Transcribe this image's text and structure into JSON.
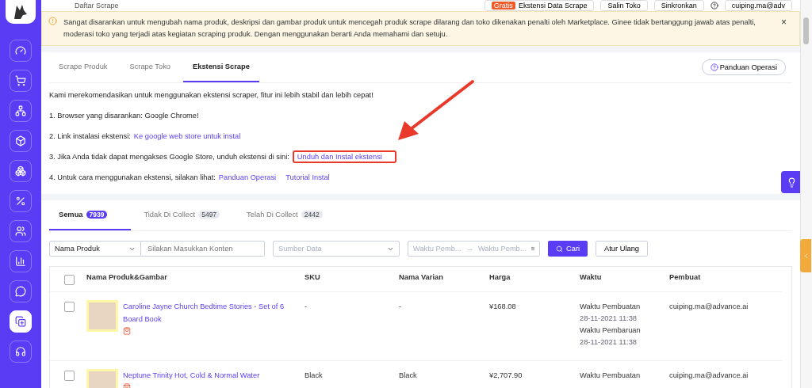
{
  "sidebar": {
    "items": [
      {
        "selected": false
      },
      {
        "selected": false
      },
      {
        "selected": false
      },
      {
        "selected": false
      },
      {
        "selected": false
      },
      {
        "selected": false
      },
      {
        "selected": false
      },
      {
        "selected": false
      },
      {
        "selected": false
      },
      {
        "selected": true
      },
      {
        "selected": false
      }
    ]
  },
  "header": {
    "title": "Daftar Scrape",
    "badge": "Gratis",
    "buttons": [
      "Ekstensi Data Scrape",
      "Salin Toko",
      "Sinkronkan"
    ],
    "user": "cuiping.ma@adv"
  },
  "banner": {
    "text": "Sangat disarankan untuk mengubah nama produk, deskripsi dan gambar produk untuk mencegah produk scrape dilarang dan toko dikenakan penalti oleh Marketplace. Ginee tidak bertanggung jawab atas penalti, moderasi toko yang terjadi atas kegiatan scraping produk. Dengan menggunakan berarti Anda memahami dan setuju.",
    "close": "×"
  },
  "top_tabs": [
    {
      "label": "Scrape Produk",
      "selected": false
    },
    {
      "label": "Scrape Toko",
      "selected": false
    },
    {
      "label": "Ekstensi Scrape",
      "selected": true
    }
  ],
  "guide_button": "Panduan Operasi",
  "intro": "Kami merekomendasikan untuk menggunakan ekstensi scraper, fitur ini lebih stabil dan lebih cepat!",
  "steps": [
    {
      "text": "1. Browser yang disarankan: Google Chrome!",
      "highlighted": false
    },
    {
      "text": "2. Link instalasi ekstensi:",
      "links": [
        "Ke google web store untuk instal"
      ],
      "highlighted": false
    },
    {
      "text": "3. Jika Anda tidak dapat mengakses Google Store, unduh ekstensi di sini:",
      "links": [
        "Unduh dan Instal ekstensi"
      ],
      "highlighted": true
    },
    {
      "text": "4. Untuk cara menggunakan ekstensi, silakan lihat:",
      "links": [
        "Panduan Operasi",
        "Tutorial Instal"
      ],
      "highlighted": false
    }
  ],
  "list_tabs": [
    {
      "label": "Semua",
      "count": "7939",
      "selected": true
    },
    {
      "label": "Tidak Di Collect",
      "count": "5497",
      "selected": false
    },
    {
      "label": "Telah Di Collect",
      "count": "2442",
      "selected": false
    }
  ],
  "filters": {
    "field_select": "Nama Produk",
    "search_placeholder": "Silakan Masukkan Konten",
    "source_placeholder": "Sumber Data",
    "date_start_placeholder": "Waktu Pemb...",
    "date_separator": "→",
    "date_end_placeholder": "Waktu Pemb...",
    "search_button": "Cari",
    "reset_button": "Atur Ulang"
  },
  "table": {
    "select_all_checked": false,
    "columns": [
      "Nama Produk&Gambar",
      "SKU",
      "Nama Varian",
      "Harga",
      "Waktu",
      "Pembuat"
    ],
    "rows": [
      {
        "checked": false,
        "name": "Caroline Jayne Church Bedtime Stories - Set of 6 Board Book",
        "sku": "-",
        "variant": "-",
        "price": "¥168.08",
        "times": [
          {
            "label": "Waktu Pembuatan",
            "value": "28-11-2021 11:38"
          },
          {
            "label": "Waktu Pembaruan",
            "value": "28-11-2021 11:38"
          }
        ],
        "creator": "cuiping.ma@advance.ai"
      },
      {
        "checked": false,
        "name": "Neptune Trinity Hot, Cold & Normal Water",
        "sku": "Black",
        "variant": "Black",
        "price": "¥2,707.90",
        "times": [
          {
            "label": "Waktu Pembuatan"
          }
        ],
        "creator": "cuiping.ma@advance.ai"
      }
    ]
  }
}
